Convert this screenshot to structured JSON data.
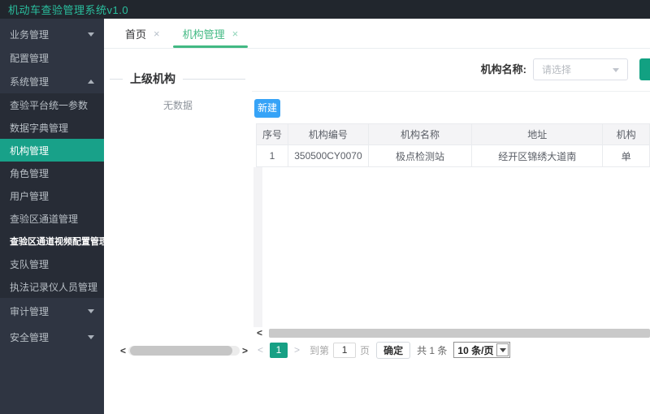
{
  "app": {
    "title": "机动车查验管理系统v1.0"
  },
  "sidebar": {
    "items": [
      {
        "label": "业务管理"
      },
      {
        "label": "配置管理"
      },
      {
        "label": "系统管理"
      },
      {
        "label": "查验平台统一参数"
      },
      {
        "label": "数据字典管理"
      },
      {
        "label": "机构管理"
      },
      {
        "label": "角色管理"
      },
      {
        "label": "用户管理"
      },
      {
        "label": "查验区通道管理"
      },
      {
        "label": "查验区通道视频配置管理"
      },
      {
        "label": "支队管理"
      },
      {
        "label": "执法记录仪人员管理"
      },
      {
        "label": "审计管理"
      },
      {
        "label": "安全管理"
      }
    ]
  },
  "tabs": {
    "items": [
      {
        "label": "首页"
      },
      {
        "label": "机构管理"
      }
    ],
    "close_icon": "×"
  },
  "tree": {
    "title": "上级机构",
    "empty_text": "无数据"
  },
  "search": {
    "label": "机构名称:",
    "placeholder": "请选择"
  },
  "toolbar": {
    "new_button": "新建"
  },
  "table": {
    "columns": [
      "序号",
      "机构编号",
      "机构名称",
      "地址",
      "机构"
    ],
    "rows": [
      [
        "1",
        "350500CY0070",
        "极点检测站",
        "经开区锦绣大道南",
        "单"
      ]
    ]
  },
  "pagination": {
    "prev_icon": "<",
    "page": "1",
    "next_icon": ">",
    "goto_label": "到第",
    "goto_value": "1",
    "page_unit": "页",
    "confirm_label": "确定",
    "total_label": "共 1 条",
    "page_size": "10 条/页"
  },
  "scrollbars": {
    "left_icon": "<",
    "right_icon": ">"
  },
  "colors": {
    "title_green": "#2abf9e",
    "sidebar_selected_teal": "#18a189",
    "tab_active_green": "#42b983",
    "new_button_blue": "#36a3f7",
    "search_button_teal": "#12a182",
    "pagination_green": "#17a084"
  }
}
